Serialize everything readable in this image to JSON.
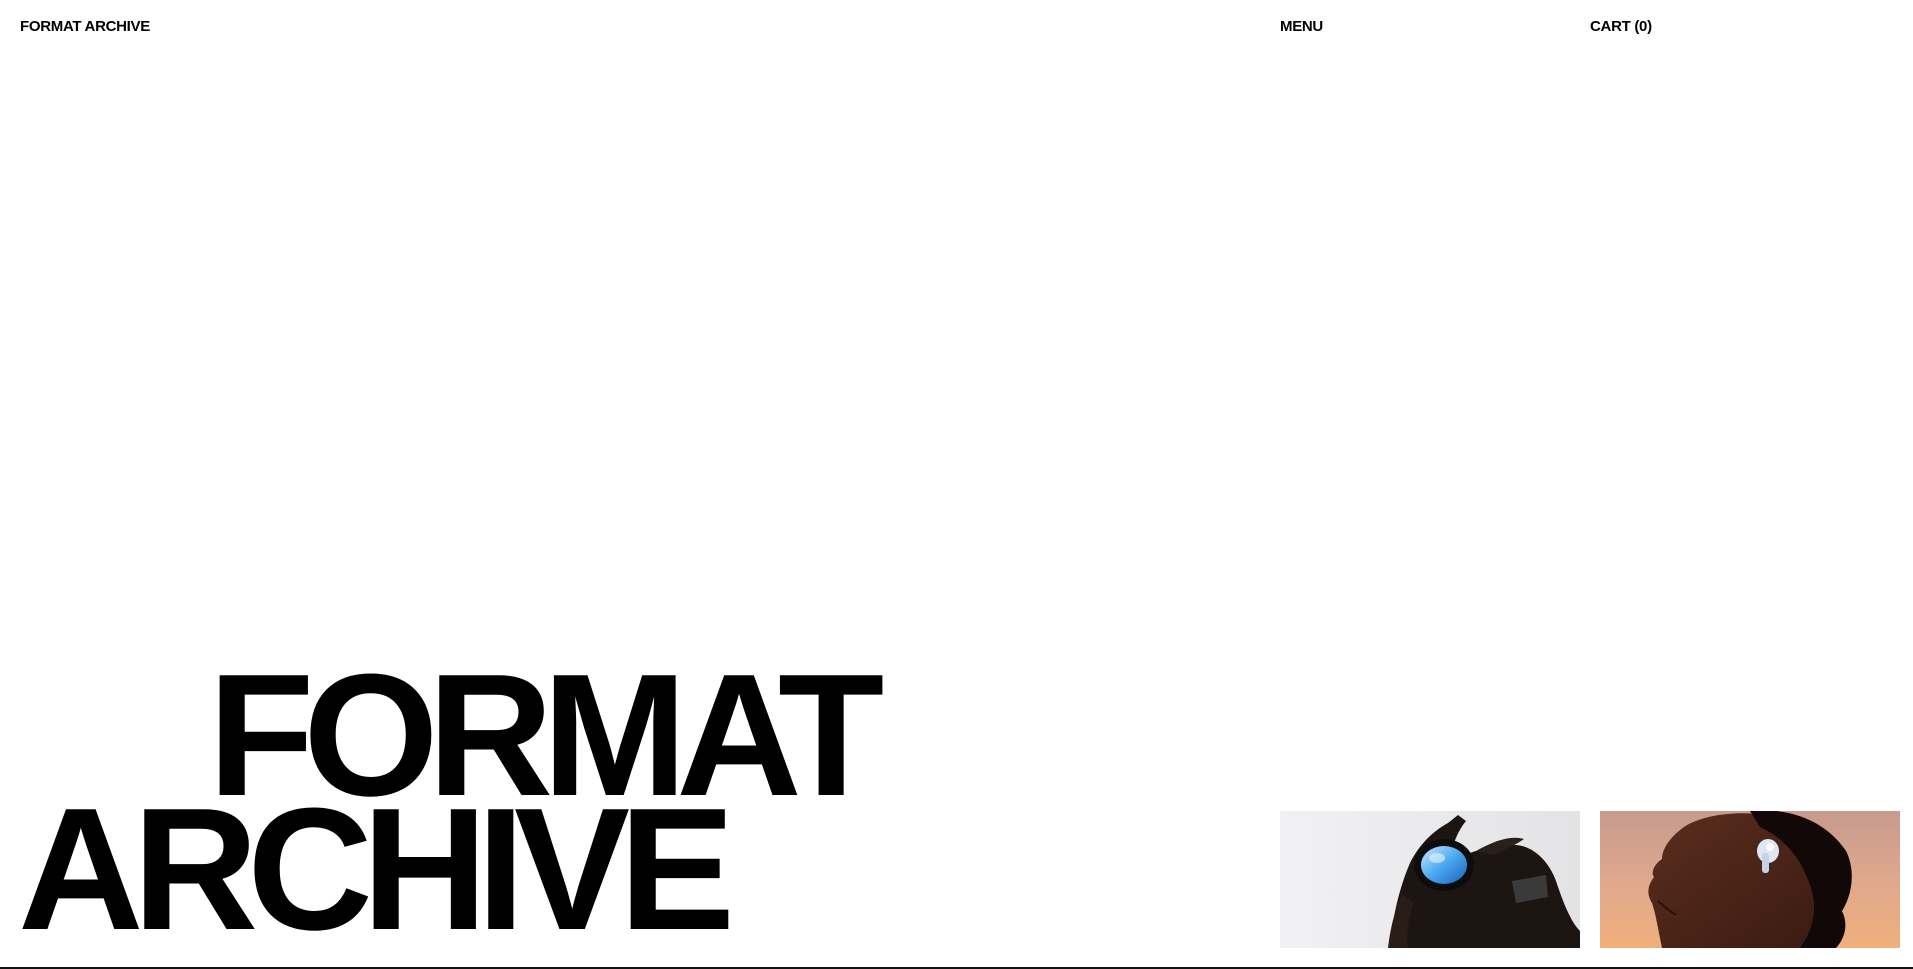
{
  "header": {
    "brand": "FORMAT ARCHIVE",
    "menu_label": "MENU",
    "cart_label": "CART (0)"
  },
  "hero": {
    "line1": "FORMAT",
    "line2": "ARCHIVE"
  },
  "gallery": {
    "items": [
      {
        "name": "hand holding round lens product"
      },
      {
        "name": "profile with wireless earbud"
      }
    ]
  },
  "colors": {
    "background": "#ffffff",
    "text": "#000000",
    "thumb1_bg": "#ececec",
    "thumb2_bg": "#e0a98c"
  }
}
